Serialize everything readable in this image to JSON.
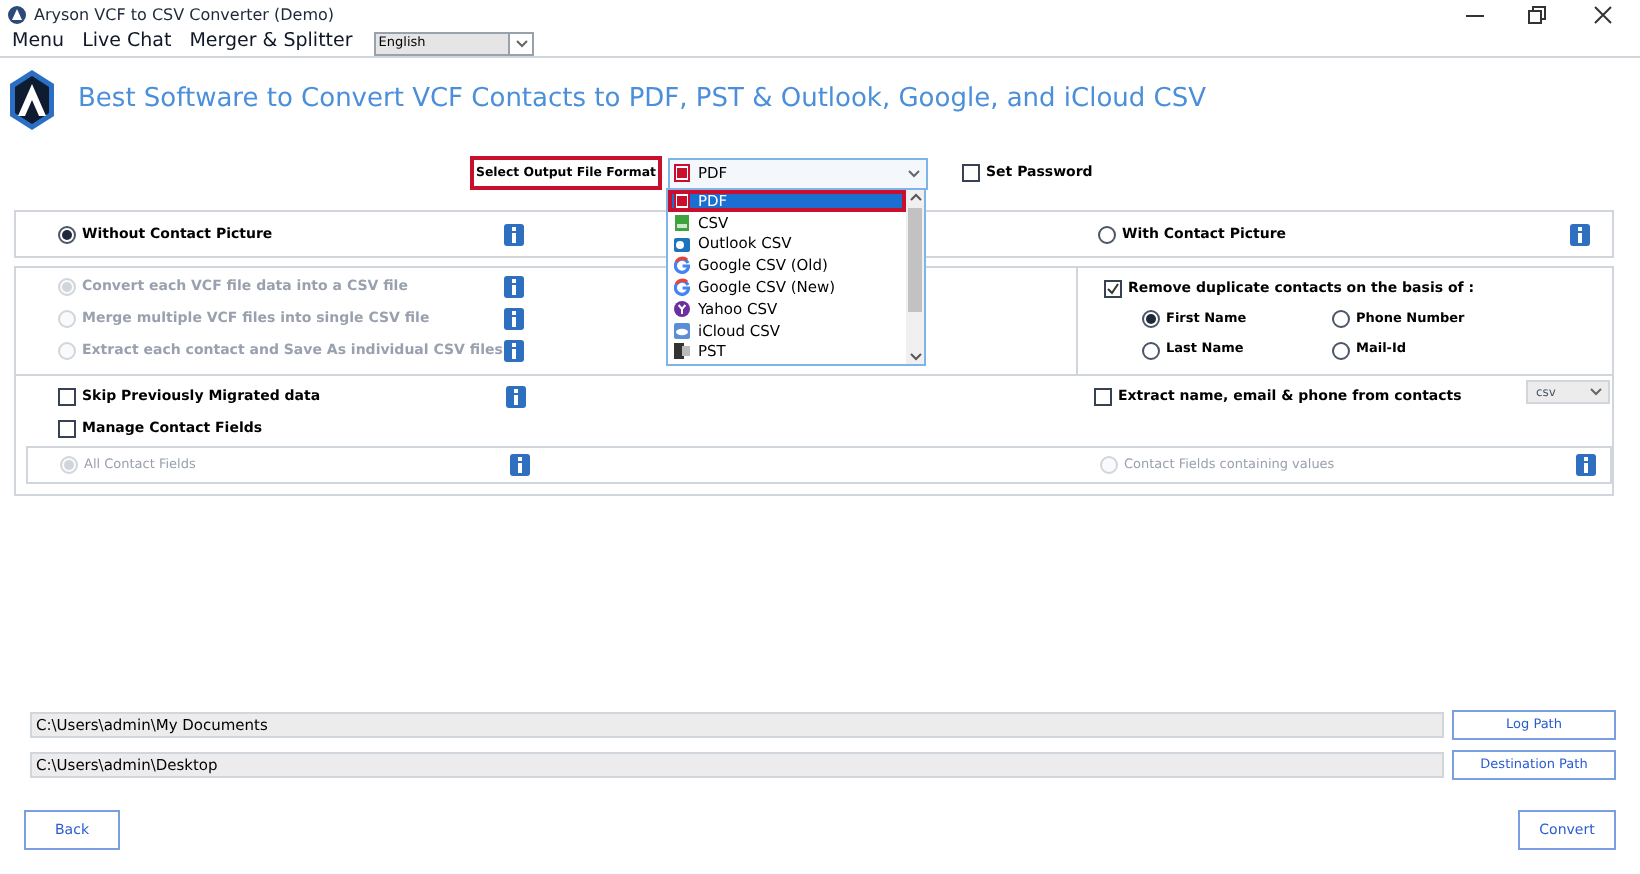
{
  "window": {
    "title": "Aryson VCF to CSV Converter (Demo)"
  },
  "menu": [
    "Menu",
    "Live Chat",
    "Merger & Splitter"
  ],
  "language_select": {
    "value": "English"
  },
  "header": {
    "title": "Best Software to Convert VCF Contacts to PDF, PST & Outlook, Google, and iCloud CSV"
  },
  "output_format": {
    "label": "Select Output File Format",
    "value": "PDF",
    "expanded": true,
    "options": [
      {
        "label": "PDF",
        "kind": "pdf",
        "selected": true
      },
      {
        "label": "CSV",
        "kind": "csv",
        "selected": false
      },
      {
        "label": "Outlook CSV",
        "kind": "outlook",
        "selected": false
      },
      {
        "label": "Google CSV (Old)",
        "kind": "google",
        "selected": false
      },
      {
        "label": "Google CSV (New)",
        "kind": "google",
        "selected": false
      },
      {
        "label": "Yahoo CSV",
        "kind": "yahoo",
        "selected": false
      },
      {
        "label": "iCloud CSV",
        "kind": "icloud",
        "selected": false
      },
      {
        "label": "PST",
        "kind": "pst",
        "selected": false
      }
    ]
  },
  "set_password": {
    "label": "Set Password",
    "checked": false
  },
  "picture_mode": [
    {
      "label": "Without Contact Picture",
      "selected": true
    },
    {
      "label": "With Contact Picture",
      "selected": false
    }
  ],
  "conversion_options": [
    {
      "label": "Convert each VCF file data into a CSV file",
      "selected": true,
      "disabled": true
    },
    {
      "label": "Merge multiple VCF files into single CSV file",
      "selected": false,
      "disabled": true
    },
    {
      "label": "Extract each contact and  Save As individual CSV files",
      "selected": false,
      "disabled": true
    }
  ],
  "remove_duplicates": {
    "label": "Remove duplicate contacts on the basis of :",
    "checked": true,
    "criteria": [
      {
        "label": "First Name",
        "selected": true
      },
      {
        "label": "Phone Number",
        "selected": false
      },
      {
        "label": "Last Name",
        "selected": false
      },
      {
        "label": "Mail-Id",
        "selected": false
      }
    ]
  },
  "skip_migrated": {
    "label": "Skip Previously Migrated data",
    "checked": false
  },
  "extract_contacts": {
    "label": "Extract name, email & phone from contacts",
    "checked": false,
    "format": "csv"
  },
  "manage_fields": {
    "label": "Manage Contact Fields",
    "checked": false,
    "options": [
      {
        "label": "All Contact  Fields",
        "selected": true,
        "disabled": true
      },
      {
        "label": "Contact Fields containing values",
        "selected": false,
        "disabled": true
      }
    ]
  },
  "paths": [
    {
      "value": "C:\\Users\\admin\\My Documents",
      "button": "Log Path"
    },
    {
      "value": "C:\\Users\\admin\\Desktop",
      "button": "Destination Path"
    }
  ],
  "buttons": {
    "back": "Back",
    "convert": "Convert"
  }
}
